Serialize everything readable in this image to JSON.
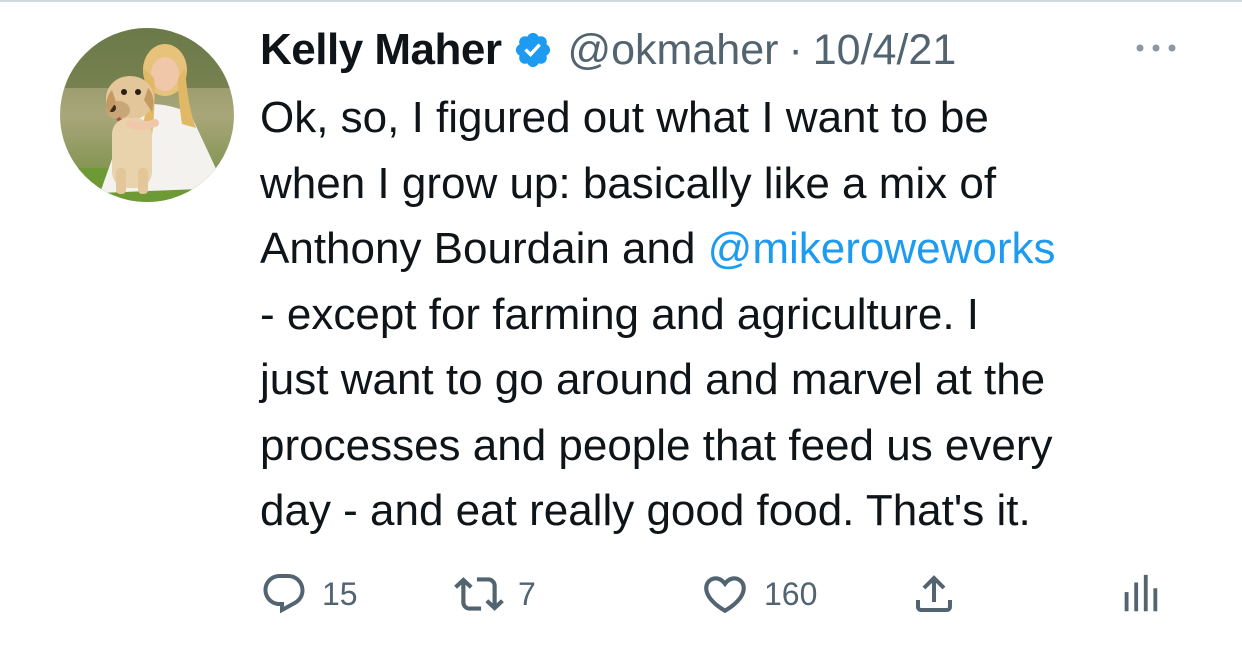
{
  "tweet": {
    "author_name": "Kelly Maher",
    "handle": "@okmaher",
    "separator": "·",
    "date": "10/4/21",
    "verified": true,
    "text_lines": [
      {
        "before": "Ok, so, I figured out what I want to be",
        "mention": "",
        "after": ""
      },
      {
        "before": "when I grow up: basically like a mix of",
        "mention": "",
        "after": ""
      },
      {
        "before": "Anthony Bourdain and ",
        "mention": "@mikeroweworks",
        "after": ""
      },
      {
        "before": "- except for farming and agriculture. I",
        "mention": "",
        "after": ""
      },
      {
        "before": "just want to go around and marvel at the",
        "mention": "",
        "after": ""
      },
      {
        "before": "processes and people that feed us every",
        "mention": "",
        "after": ""
      },
      {
        "before": "day - and eat really good food. That's it.",
        "mention": "",
        "after": ""
      }
    ]
  },
  "actions": {
    "reply_count": "15",
    "retweet_count": "7",
    "like_count": "160"
  },
  "icons": {
    "reply": "reply-icon",
    "retweet": "retweet-icon",
    "like": "heart-icon",
    "share": "share-icon",
    "analytics": "analytics-icon",
    "more": "more-options-icon",
    "verified": "verified-badge-icon"
  },
  "colors": {
    "text": "#0f1419",
    "secondary": "#536471",
    "accent": "#1d9bf0"
  }
}
